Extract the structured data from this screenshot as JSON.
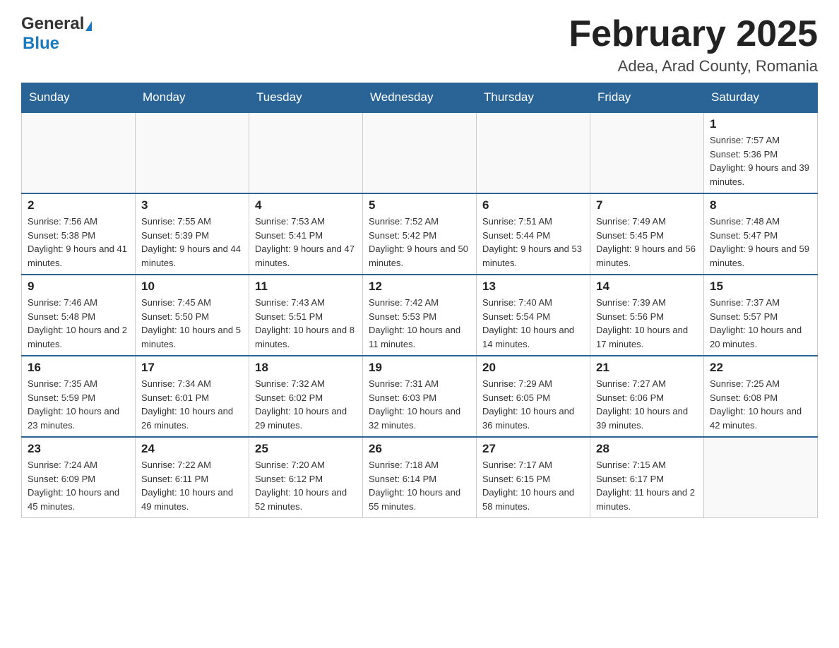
{
  "header": {
    "logo_general": "General",
    "logo_blue": "Blue",
    "month_title": "February 2025",
    "location": "Adea, Arad County, Romania"
  },
  "calendar": {
    "days_of_week": [
      "Sunday",
      "Monday",
      "Tuesday",
      "Wednesday",
      "Thursday",
      "Friday",
      "Saturday"
    ],
    "weeks": [
      [
        {
          "day": "",
          "info": ""
        },
        {
          "day": "",
          "info": ""
        },
        {
          "day": "",
          "info": ""
        },
        {
          "day": "",
          "info": ""
        },
        {
          "day": "",
          "info": ""
        },
        {
          "day": "",
          "info": ""
        },
        {
          "day": "1",
          "info": "Sunrise: 7:57 AM\nSunset: 5:36 PM\nDaylight: 9 hours and 39 minutes."
        }
      ],
      [
        {
          "day": "2",
          "info": "Sunrise: 7:56 AM\nSunset: 5:38 PM\nDaylight: 9 hours and 41 minutes."
        },
        {
          "day": "3",
          "info": "Sunrise: 7:55 AM\nSunset: 5:39 PM\nDaylight: 9 hours and 44 minutes."
        },
        {
          "day": "4",
          "info": "Sunrise: 7:53 AM\nSunset: 5:41 PM\nDaylight: 9 hours and 47 minutes."
        },
        {
          "day": "5",
          "info": "Sunrise: 7:52 AM\nSunset: 5:42 PM\nDaylight: 9 hours and 50 minutes."
        },
        {
          "day": "6",
          "info": "Sunrise: 7:51 AM\nSunset: 5:44 PM\nDaylight: 9 hours and 53 minutes."
        },
        {
          "day": "7",
          "info": "Sunrise: 7:49 AM\nSunset: 5:45 PM\nDaylight: 9 hours and 56 minutes."
        },
        {
          "day": "8",
          "info": "Sunrise: 7:48 AM\nSunset: 5:47 PM\nDaylight: 9 hours and 59 minutes."
        }
      ],
      [
        {
          "day": "9",
          "info": "Sunrise: 7:46 AM\nSunset: 5:48 PM\nDaylight: 10 hours and 2 minutes."
        },
        {
          "day": "10",
          "info": "Sunrise: 7:45 AM\nSunset: 5:50 PM\nDaylight: 10 hours and 5 minutes."
        },
        {
          "day": "11",
          "info": "Sunrise: 7:43 AM\nSunset: 5:51 PM\nDaylight: 10 hours and 8 minutes."
        },
        {
          "day": "12",
          "info": "Sunrise: 7:42 AM\nSunset: 5:53 PM\nDaylight: 10 hours and 11 minutes."
        },
        {
          "day": "13",
          "info": "Sunrise: 7:40 AM\nSunset: 5:54 PM\nDaylight: 10 hours and 14 minutes."
        },
        {
          "day": "14",
          "info": "Sunrise: 7:39 AM\nSunset: 5:56 PM\nDaylight: 10 hours and 17 minutes."
        },
        {
          "day": "15",
          "info": "Sunrise: 7:37 AM\nSunset: 5:57 PM\nDaylight: 10 hours and 20 minutes."
        }
      ],
      [
        {
          "day": "16",
          "info": "Sunrise: 7:35 AM\nSunset: 5:59 PM\nDaylight: 10 hours and 23 minutes."
        },
        {
          "day": "17",
          "info": "Sunrise: 7:34 AM\nSunset: 6:01 PM\nDaylight: 10 hours and 26 minutes."
        },
        {
          "day": "18",
          "info": "Sunrise: 7:32 AM\nSunset: 6:02 PM\nDaylight: 10 hours and 29 minutes."
        },
        {
          "day": "19",
          "info": "Sunrise: 7:31 AM\nSunset: 6:03 PM\nDaylight: 10 hours and 32 minutes."
        },
        {
          "day": "20",
          "info": "Sunrise: 7:29 AM\nSunset: 6:05 PM\nDaylight: 10 hours and 36 minutes."
        },
        {
          "day": "21",
          "info": "Sunrise: 7:27 AM\nSunset: 6:06 PM\nDaylight: 10 hours and 39 minutes."
        },
        {
          "day": "22",
          "info": "Sunrise: 7:25 AM\nSunset: 6:08 PM\nDaylight: 10 hours and 42 minutes."
        }
      ],
      [
        {
          "day": "23",
          "info": "Sunrise: 7:24 AM\nSunset: 6:09 PM\nDaylight: 10 hours and 45 minutes."
        },
        {
          "day": "24",
          "info": "Sunrise: 7:22 AM\nSunset: 6:11 PM\nDaylight: 10 hours and 49 minutes."
        },
        {
          "day": "25",
          "info": "Sunrise: 7:20 AM\nSunset: 6:12 PM\nDaylight: 10 hours and 52 minutes."
        },
        {
          "day": "26",
          "info": "Sunrise: 7:18 AM\nSunset: 6:14 PM\nDaylight: 10 hours and 55 minutes."
        },
        {
          "day": "27",
          "info": "Sunrise: 7:17 AM\nSunset: 6:15 PM\nDaylight: 10 hours and 58 minutes."
        },
        {
          "day": "28",
          "info": "Sunrise: 7:15 AM\nSunset: 6:17 PM\nDaylight: 11 hours and 2 minutes."
        },
        {
          "day": "",
          "info": ""
        }
      ]
    ]
  }
}
